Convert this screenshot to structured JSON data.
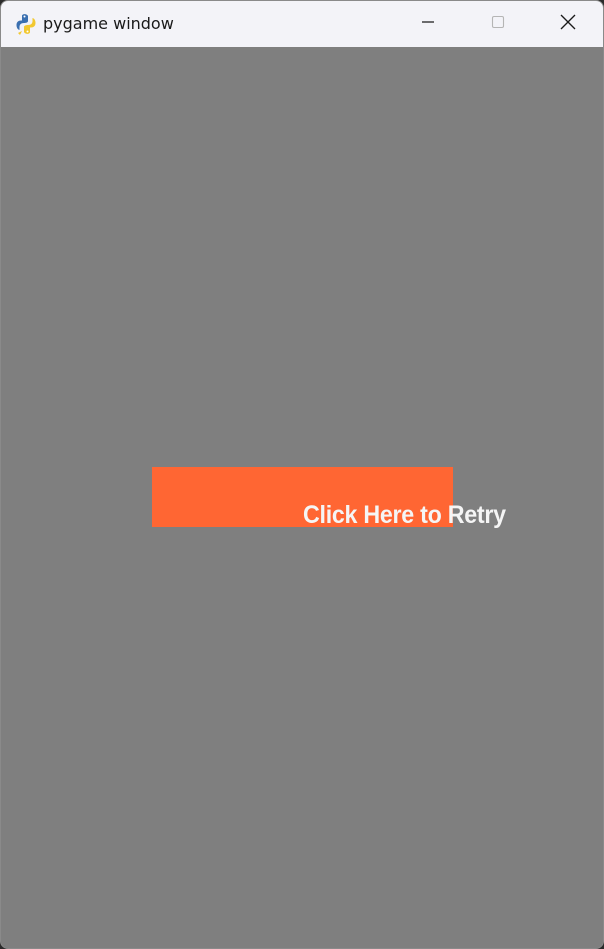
{
  "window": {
    "title": "pygame window",
    "icon": "pygame-snake-icon",
    "controls": [
      "minimize-icon",
      "maximize-icon",
      "close-icon"
    ]
  },
  "game": {
    "background_color": "#7f7f7f",
    "retry_button": {
      "label": "Click Here to Retry",
      "fill_color": "#ff6633",
      "text_color": "#f5f5f5"
    }
  }
}
